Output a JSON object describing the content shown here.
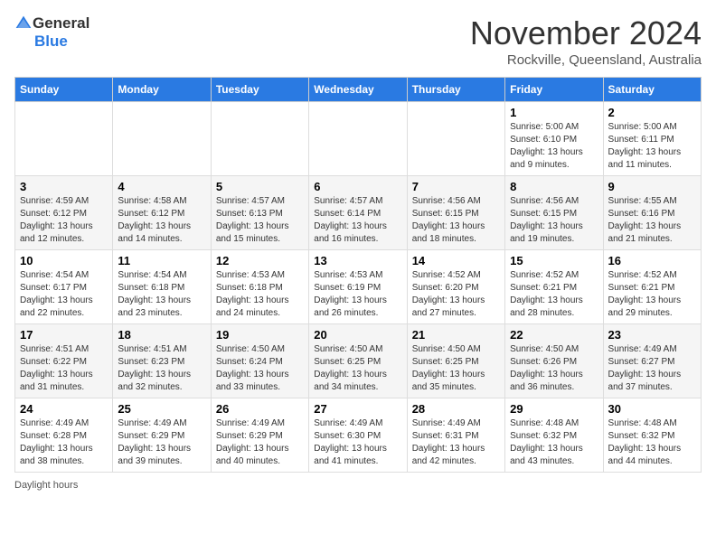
{
  "logo": {
    "general": "General",
    "blue": "Blue"
  },
  "header": {
    "month": "November 2024",
    "location": "Rockville, Queensland, Australia"
  },
  "columns": [
    "Sunday",
    "Monday",
    "Tuesday",
    "Wednesday",
    "Thursday",
    "Friday",
    "Saturday"
  ],
  "weeks": [
    [
      {
        "day": "",
        "info": ""
      },
      {
        "day": "",
        "info": ""
      },
      {
        "day": "",
        "info": ""
      },
      {
        "day": "",
        "info": ""
      },
      {
        "day": "",
        "info": ""
      },
      {
        "day": "1",
        "info": "Sunrise: 5:00 AM\nSunset: 6:10 PM\nDaylight: 13 hours and 9 minutes."
      },
      {
        "day": "2",
        "info": "Sunrise: 5:00 AM\nSunset: 6:11 PM\nDaylight: 13 hours and 11 minutes."
      }
    ],
    [
      {
        "day": "3",
        "info": "Sunrise: 4:59 AM\nSunset: 6:12 PM\nDaylight: 13 hours and 12 minutes."
      },
      {
        "day": "4",
        "info": "Sunrise: 4:58 AM\nSunset: 6:12 PM\nDaylight: 13 hours and 14 minutes."
      },
      {
        "day": "5",
        "info": "Sunrise: 4:57 AM\nSunset: 6:13 PM\nDaylight: 13 hours and 15 minutes."
      },
      {
        "day": "6",
        "info": "Sunrise: 4:57 AM\nSunset: 6:14 PM\nDaylight: 13 hours and 16 minutes."
      },
      {
        "day": "7",
        "info": "Sunrise: 4:56 AM\nSunset: 6:15 PM\nDaylight: 13 hours and 18 minutes."
      },
      {
        "day": "8",
        "info": "Sunrise: 4:56 AM\nSunset: 6:15 PM\nDaylight: 13 hours and 19 minutes."
      },
      {
        "day": "9",
        "info": "Sunrise: 4:55 AM\nSunset: 6:16 PM\nDaylight: 13 hours and 21 minutes."
      }
    ],
    [
      {
        "day": "10",
        "info": "Sunrise: 4:54 AM\nSunset: 6:17 PM\nDaylight: 13 hours and 22 minutes."
      },
      {
        "day": "11",
        "info": "Sunrise: 4:54 AM\nSunset: 6:18 PM\nDaylight: 13 hours and 23 minutes."
      },
      {
        "day": "12",
        "info": "Sunrise: 4:53 AM\nSunset: 6:18 PM\nDaylight: 13 hours and 24 minutes."
      },
      {
        "day": "13",
        "info": "Sunrise: 4:53 AM\nSunset: 6:19 PM\nDaylight: 13 hours and 26 minutes."
      },
      {
        "day": "14",
        "info": "Sunrise: 4:52 AM\nSunset: 6:20 PM\nDaylight: 13 hours and 27 minutes."
      },
      {
        "day": "15",
        "info": "Sunrise: 4:52 AM\nSunset: 6:21 PM\nDaylight: 13 hours and 28 minutes."
      },
      {
        "day": "16",
        "info": "Sunrise: 4:52 AM\nSunset: 6:21 PM\nDaylight: 13 hours and 29 minutes."
      }
    ],
    [
      {
        "day": "17",
        "info": "Sunrise: 4:51 AM\nSunset: 6:22 PM\nDaylight: 13 hours and 31 minutes."
      },
      {
        "day": "18",
        "info": "Sunrise: 4:51 AM\nSunset: 6:23 PM\nDaylight: 13 hours and 32 minutes."
      },
      {
        "day": "19",
        "info": "Sunrise: 4:50 AM\nSunset: 6:24 PM\nDaylight: 13 hours and 33 minutes."
      },
      {
        "day": "20",
        "info": "Sunrise: 4:50 AM\nSunset: 6:25 PM\nDaylight: 13 hours and 34 minutes."
      },
      {
        "day": "21",
        "info": "Sunrise: 4:50 AM\nSunset: 6:25 PM\nDaylight: 13 hours and 35 minutes."
      },
      {
        "day": "22",
        "info": "Sunrise: 4:50 AM\nSunset: 6:26 PM\nDaylight: 13 hours and 36 minutes."
      },
      {
        "day": "23",
        "info": "Sunrise: 4:49 AM\nSunset: 6:27 PM\nDaylight: 13 hours and 37 minutes."
      }
    ],
    [
      {
        "day": "24",
        "info": "Sunrise: 4:49 AM\nSunset: 6:28 PM\nDaylight: 13 hours and 38 minutes."
      },
      {
        "day": "25",
        "info": "Sunrise: 4:49 AM\nSunset: 6:29 PM\nDaylight: 13 hours and 39 minutes."
      },
      {
        "day": "26",
        "info": "Sunrise: 4:49 AM\nSunset: 6:29 PM\nDaylight: 13 hours and 40 minutes."
      },
      {
        "day": "27",
        "info": "Sunrise: 4:49 AM\nSunset: 6:30 PM\nDaylight: 13 hours and 41 minutes."
      },
      {
        "day": "28",
        "info": "Sunrise: 4:49 AM\nSunset: 6:31 PM\nDaylight: 13 hours and 42 minutes."
      },
      {
        "day": "29",
        "info": "Sunrise: 4:48 AM\nSunset: 6:32 PM\nDaylight: 13 hours and 43 minutes."
      },
      {
        "day": "30",
        "info": "Sunrise: 4:48 AM\nSunset: 6:32 PM\nDaylight: 13 hours and 44 minutes."
      }
    ]
  ],
  "footer": {
    "daylight_label": "Daylight hours"
  }
}
